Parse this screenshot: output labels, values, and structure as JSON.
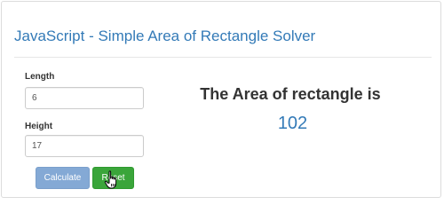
{
  "header": {
    "title": "JavaScript - Simple Area of Rectangle Solver"
  },
  "form": {
    "length_label": "Length",
    "length_value": "6",
    "height_label": "Height",
    "height_value": "17",
    "calculate_label": "Calculate",
    "reset_label": "Reset"
  },
  "result": {
    "heading": "The Area of rectangle is",
    "value": "102"
  },
  "colors": {
    "title": "#337ab7",
    "calculate_button": "#84a9d5",
    "reset_button": "#3aa53a",
    "result_value": "#337ab7"
  },
  "icons": {
    "cursor": "hand-pointer-icon"
  }
}
